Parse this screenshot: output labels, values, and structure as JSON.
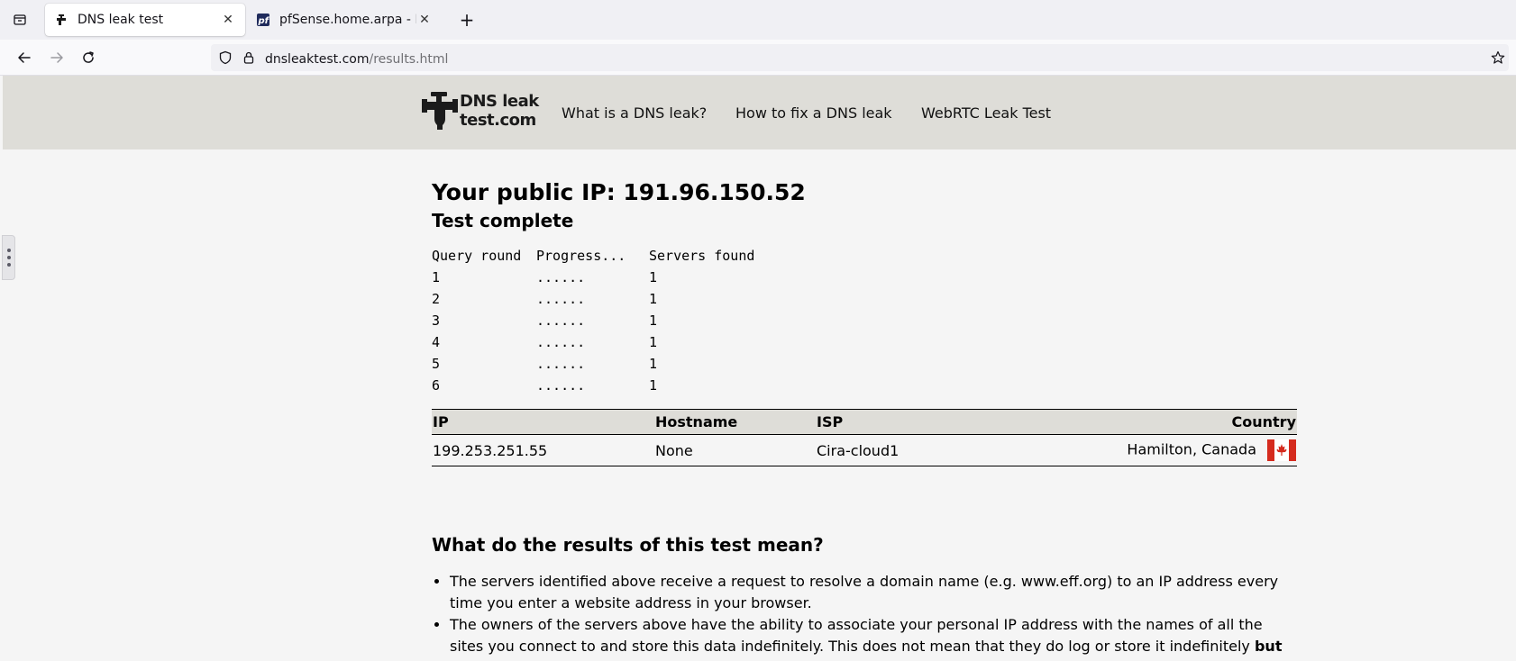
{
  "browser": {
    "tabs": [
      {
        "title": "DNS leak test",
        "active": true
      },
      {
        "title": "pfSense.home.arpa - Fire",
        "active": false
      }
    ],
    "url": {
      "host": "dnsleaktest.com",
      "path": "/results.html"
    }
  },
  "site": {
    "logo": {
      "line1": "DNS leak",
      "line2": "test.com"
    },
    "nav": [
      "What is a DNS leak?",
      "How to fix a DNS leak",
      "WebRTC Leak Test"
    ]
  },
  "page": {
    "title": "Your public IP: 191.96.150.52",
    "status": "Test complete",
    "rounds": {
      "headers": [
        "Query round",
        "Progress...",
        "Servers found"
      ],
      "rows": [
        {
          "round": "1",
          "progress": "......",
          "servers": "1"
        },
        {
          "round": "2",
          "progress": "......",
          "servers": "1"
        },
        {
          "round": "3",
          "progress": "......",
          "servers": "1"
        },
        {
          "round": "4",
          "progress": "......",
          "servers": "1"
        },
        {
          "round": "5",
          "progress": "......",
          "servers": "1"
        },
        {
          "round": "6",
          "progress": "......",
          "servers": "1"
        }
      ]
    },
    "results": {
      "headers": [
        "IP",
        "Hostname",
        "ISP",
        "Country"
      ],
      "rows": [
        {
          "ip": "199.253.251.55",
          "hostname": "None",
          "isp": "Cira-cloud1",
          "country": "Hamilton, Canada",
          "flag": "canada-flag-icon"
        }
      ]
    },
    "meaning": {
      "heading": "What do the results of this test mean?",
      "bullet1": "The servers identified above receive a request to resolve a domain name (e.g. www.eff.org) to an IP address every time you enter a website address in your browser.",
      "bullet2_text": "The owners of the servers above have the ability to associate your personal IP address with the names of all the sites you connect to and store this data indefinitely. This does not mean that they do log or store it indefinitely ",
      "bullet2_bold": "but"
    }
  },
  "colors": {
    "header_bg": "#deddd8",
    "page_bg": "#f5f5f5",
    "canada_red": "#d52b1e"
  }
}
